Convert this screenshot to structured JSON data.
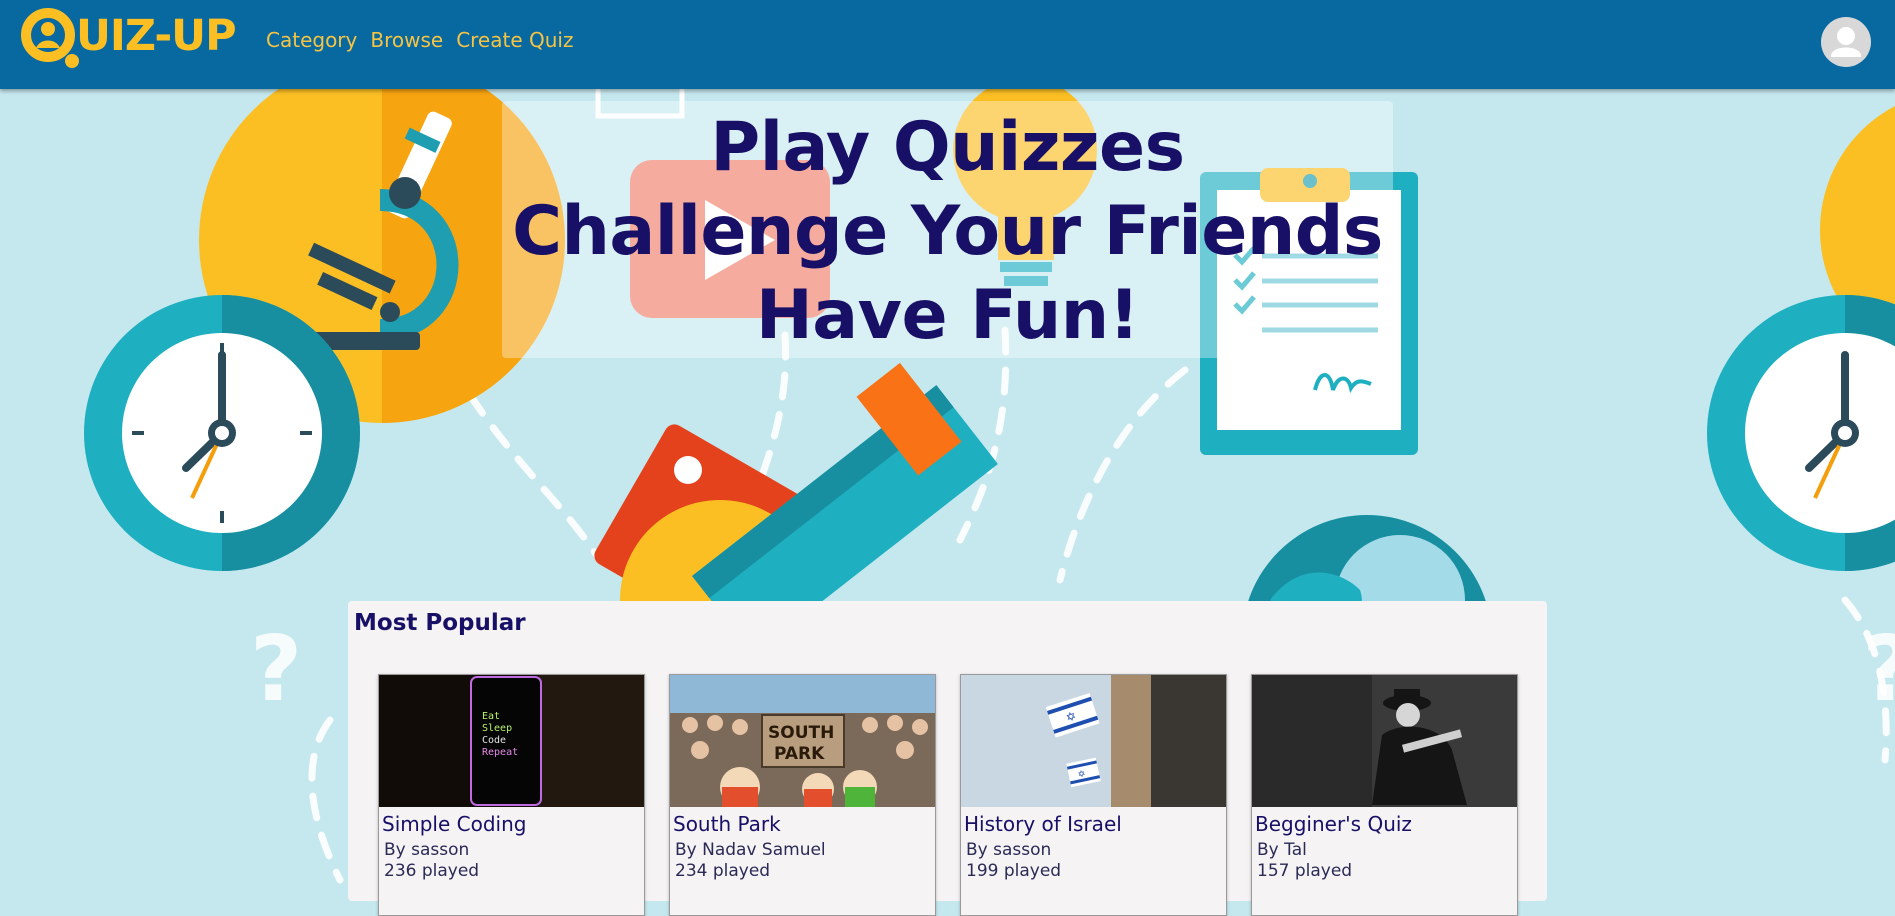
{
  "brand": {
    "name": "UIZ-UP",
    "accent": "#fbbf24",
    "navbar_color": "#0868a0"
  },
  "nav": {
    "items": [
      {
        "label": "Category"
      },
      {
        "label": "Browse"
      },
      {
        "label": "Create Quiz"
      }
    ]
  },
  "user": {
    "icon": "user-avatar-icon"
  },
  "hero": {
    "lines": [
      "Play Quizzes",
      "Challenge Your Friends",
      "Have Fun!"
    ],
    "text_color": "#180f66"
  },
  "popular": {
    "title": "Most Popular",
    "quizzes": [
      {
        "title": "Simple Coding",
        "author": "By sasson",
        "plays": "236 played",
        "thumb_text": [
          "Eat",
          "Sleep",
          "Code",
          "Repeat"
        ]
      },
      {
        "title": "South Park",
        "author": "By Nadav Samuel",
        "plays": "234 played",
        "thumb_text": [
          "SOUTH",
          "PARK"
        ]
      },
      {
        "title": "History of Israel",
        "author": "By sasson",
        "plays": "199 played"
      },
      {
        "title": "Begginer's Quiz",
        "author": "By Tal",
        "plays": "157 played"
      }
    ]
  }
}
